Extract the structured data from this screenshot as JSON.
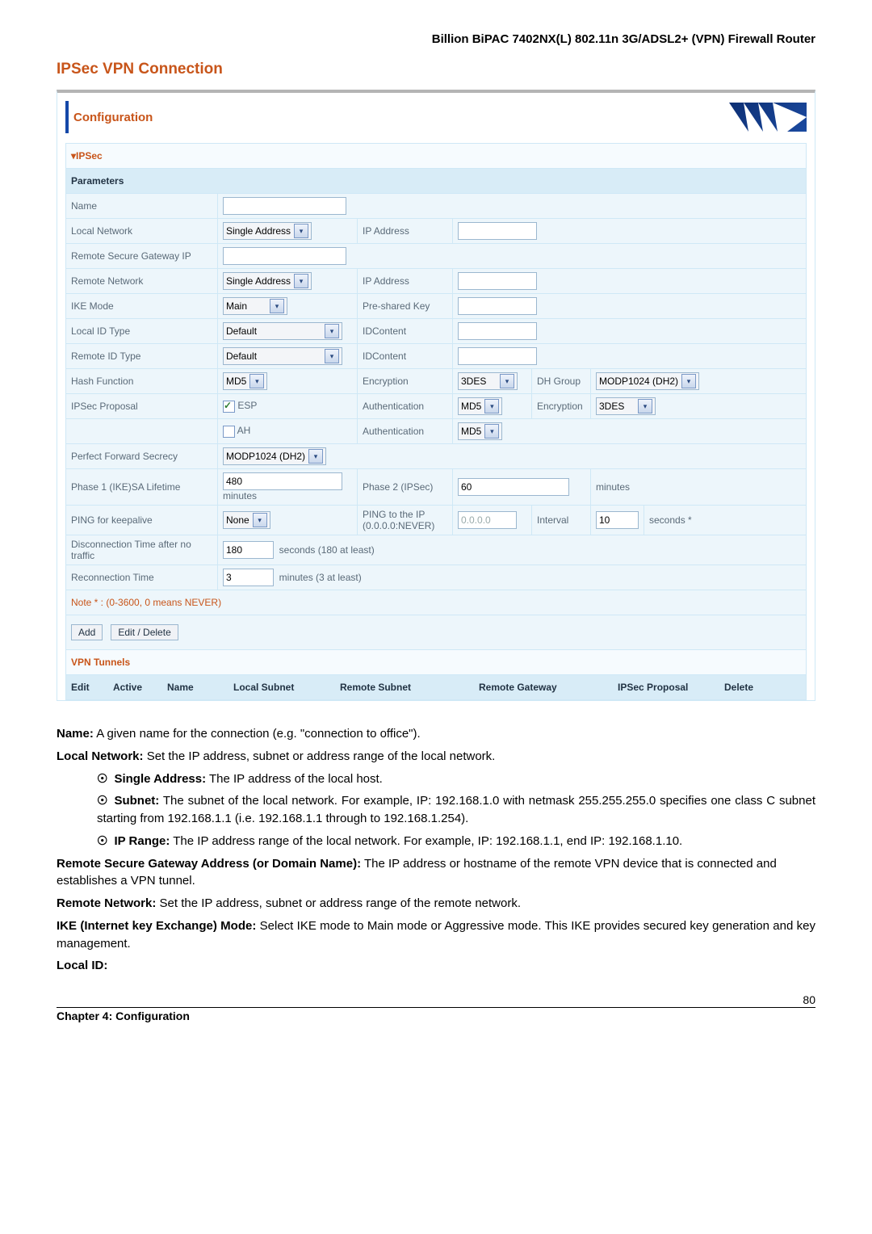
{
  "header": {
    "product": "Billion BiPAC 7402NX(L) 802.11n 3G/ADSL2+ (VPN) Firewall Router"
  },
  "section_title": "IPSec VPN Connection",
  "panel": {
    "title": "Configuration",
    "ipsec_tab": "▾IPSec",
    "parameters_hdr": "Parameters",
    "labels": {
      "name": "Name",
      "local_network": "Local Network",
      "ip_address": "IP Address",
      "remote_gateway_ip": "Remote Secure Gateway IP",
      "remote_network": "Remote Network",
      "ike_mode": "IKE Mode",
      "preshared_key": "Pre-shared Key",
      "local_id_type": "Local ID Type",
      "idcontent": "IDContent",
      "remote_id_type": "Remote ID Type",
      "hash_function": "Hash Function",
      "encryption": "Encryption",
      "dh_group": "DH Group",
      "ipsec_proposal": "IPSec Proposal",
      "authentication": "Authentication",
      "esp": "ESP",
      "ah": "AH",
      "pfs": "Perfect Forward Secrecy",
      "phase1": "Phase 1 (IKE)SA Lifetime",
      "phase2": "Phase 2 (IPSec)",
      "ping_keepalive": "PING for keepalive",
      "ping_ip": "PING to the IP (0.0.0.0:NEVER)",
      "interval": "Interval",
      "discon": "Disconnection Time after no traffic",
      "reconn": "Reconnection Time",
      "minutes": "minutes",
      "seconds_star": "seconds *",
      "seconds_180": "seconds (180 at least)",
      "minutes_3": "minutes (3 at least)"
    },
    "values": {
      "local_network_sel": "Single Address",
      "remote_network_sel": "Single Address",
      "ike_mode_sel": "Main",
      "local_id_type_sel": "Default",
      "remote_id_type_sel": "Default",
      "hash_sel": "MD5",
      "enc_sel": "3DES",
      "dh_sel": "MODP1024 (DH2)",
      "auth_sel1": "MD5",
      "enc2_sel": "3DES",
      "auth_sel2": "MD5",
      "pfs_sel": "MODP1024 (DH2)",
      "phase1_val": "480",
      "phase2_val": "60",
      "ping_sel": "None",
      "ping_ip_val": "0.0.0.0",
      "interval_val": "10",
      "discon_val": "180",
      "reconn_val": "3"
    },
    "note": "Note * : (0-3600, 0 means NEVER)",
    "add_btn": "Add",
    "editdel_btn": "Edit / Delete",
    "vpn_tunnels_hdr": "VPN Tunnels",
    "cols": {
      "edit": "Edit",
      "active": "Active",
      "name": "Name",
      "local_subnet": "Local Subnet",
      "remote_subnet": "Remote Subnet",
      "remote_gateway": "Remote Gateway",
      "ipsec_proposal": "IPSec Proposal",
      "delete": "Delete"
    }
  },
  "desc": {
    "name": {
      "b": "Name:",
      "t": " A given name for the connection (e.g. \"connection to office\")."
    },
    "local_net": {
      "b": "Local Network:",
      "t": " Set the IP address, subnet or address range of the local network."
    },
    "li1": {
      "b": "Single Address:",
      "t": " The IP address of the local host."
    },
    "li2": {
      "b": "Subnet:",
      "t": " The subnet of the local network. For example, IP: 192.168.1.0 with netmask 255.255.255.0 specifies one class C subnet starting from 192.168.1.1 (i.e. 192.168.1.1 through to 192.168.1.254)."
    },
    "li3": {
      "b": "IP Range:",
      "t": "  The IP address range of the local network. For example, IP: 192.168.1.1, end IP: 192.168.1.10."
    },
    "remote_gw": {
      "b": "Remote Secure Gateway Address (or Domain Name):",
      "t": " The IP address or hostname of the remote VPN device that is connected and establishes a VPN tunnel."
    },
    "remote_net": {
      "b": "Remote Network:",
      "t": " Set the IP address, subnet or address range of the remote network."
    },
    "ike": {
      "b": "IKE (Internet key Exchange) Mode:",
      "t": " Select IKE mode to Main mode or Aggressive mode. This IKE provides secured key generation and key management."
    },
    "local_id": {
      "b": "Local ID:",
      "t": ""
    }
  },
  "footer": {
    "chapter": "Chapter 4: Configuration",
    "page": "80"
  }
}
